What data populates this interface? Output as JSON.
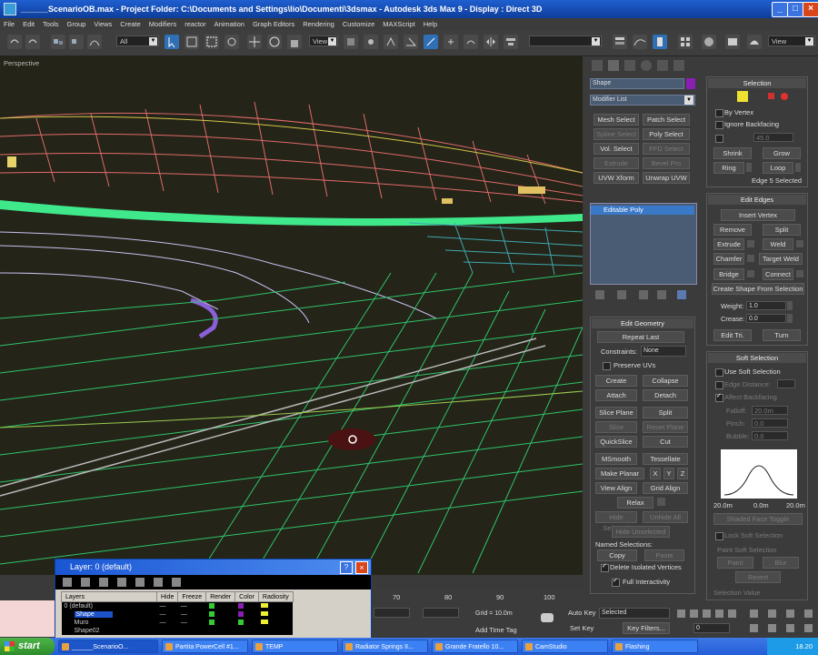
{
  "title": {
    "text": "______ScenarioOB.max - Project Folder: C:\\Documents and Settings\\lio\\Documenti\\3dsmax - Autodesk 3ds Max 9 - Display : Direct 3D"
  },
  "menu": [
    "File",
    "Edit",
    "Tools",
    "Group",
    "Views",
    "Create",
    "Modifiers",
    "reactor",
    "Animation",
    "Graph Editors",
    "Rendering",
    "Customize",
    "MAXScript",
    "Help"
  ],
  "toolbar": {
    "selection_filter": "All",
    "ref_coord": "View",
    "named_sel": "",
    "view2": "View"
  },
  "viewport": {
    "label": "Perspective"
  },
  "command_panel": {
    "object_name": "Shape",
    "object_color": "#8a1fb4",
    "modifier_list": "Modifier List",
    "modifier_buttons": [
      {
        "label": "Mesh Select",
        "enabled": true
      },
      {
        "label": "Patch Select",
        "enabled": true
      },
      {
        "label": "Spline Select",
        "enabled": false
      },
      {
        "label": "Poly Select",
        "enabled": true
      },
      {
        "label": "Vol. Select",
        "enabled": true
      },
      {
        "label": "FFD Select",
        "enabled": false
      },
      {
        "label": "Extrude",
        "enabled": false
      },
      {
        "label": "Bevel Pro",
        "enabled": false
      },
      {
        "label": "UVW Xform",
        "enabled": true
      },
      {
        "label": "Unwrap UVW",
        "enabled": true
      }
    ],
    "stack_item": "Editable Poly",
    "edit_geometry": {
      "title": "Edit Geometry",
      "repeat_last": "Repeat Last",
      "constraints_label": "Constraints:",
      "constraints_value": "None",
      "preserve_uvs": "Preserve UVs",
      "buttons": [
        {
          "label": "Create",
          "enabled": true
        },
        {
          "label": "Collapse",
          "enabled": true
        },
        {
          "label": "Attach",
          "enabled": true
        },
        {
          "label": "Detach",
          "enabled": true
        },
        {
          "label": "Slice Plane",
          "enabled": true
        },
        {
          "label": "Split",
          "enabled": true
        },
        {
          "label": "Slice",
          "enabled": false
        },
        {
          "label": "Reset Plane",
          "enabled": false
        },
        {
          "label": "QuickSlice",
          "enabled": true
        },
        {
          "label": "Cut",
          "enabled": true
        },
        {
          "label": "MSmooth",
          "enabled": true
        },
        {
          "label": "Tessellate",
          "enabled": true
        },
        {
          "label": "Make Planar",
          "enabled": true
        },
        {
          "label": "X",
          "enabled": true
        },
        {
          "label": "Y",
          "enabled": true
        },
        {
          "label": "Z",
          "enabled": true
        },
        {
          "label": "View Align",
          "enabled": true
        },
        {
          "label": "Grid Align",
          "enabled": true
        },
        {
          "label": "Relax",
          "enabled": true
        },
        {
          "label": "Hide Selected",
          "enabled": false
        },
        {
          "label": "Unhide All",
          "enabled": false
        },
        {
          "label": "Hide Unselected",
          "enabled": false
        }
      ],
      "named_selections": "Named Selections:",
      "copy": "Copy",
      "paste": "Paste",
      "delete_isolated": "Delete Isolated Vertices",
      "full_interactivity": "Full Interactivity"
    },
    "selection": {
      "title": "Selection",
      "by_vertex": "By Vertex",
      "ignore_backfacing": "Ignore Backfacing",
      "by_angle_value": "45.0",
      "shrink": "Shrink",
      "grow": "Grow",
      "ring": "Ring",
      "loop": "Loop",
      "status": "Edge 5 Selected"
    },
    "edit_edges": {
      "title": "Edit Edges",
      "insert_vertex": "Insert Vertex",
      "remove": "Remove",
      "split": "Split",
      "extrude": "Extrude",
      "weld": "Weld",
      "chamfer": "Chamfer",
      "target_weld": "Target Weld",
      "bridge": "Bridge",
      "connect": "Connect",
      "create_shape": "Create Shape From Selection",
      "weight_label": "Weight:",
      "weight_value": "1.0",
      "crease_label": "Crease:",
      "crease_value": "0.0",
      "edit_tri": "Edit Tri.",
      "turn": "Turn"
    },
    "soft_selection": {
      "title": "Soft Selection",
      "use_soft": "Use Soft Selection",
      "edge_distance": "Edge Distance:",
      "affect_backfacing": "Affect Backfacing",
      "falloff": "Falloff:",
      "falloff_value": "20.0m",
      "pinch": "Pinch:",
      "pinch_value": "0.0",
      "bubble": "Bubble:",
      "bubble_value": "0.0",
      "curve_labels": [
        "20.0m",
        "0.0m",
        "20.0m"
      ],
      "shaded_face": "Shaded Face Toggle",
      "lock_soft": "Lock Soft Selection",
      "paint_title": "Paint Soft Selection",
      "paint": "Paint",
      "blur": "Blur",
      "revert": "Revert",
      "selection_value": "Selection Value"
    }
  },
  "layer_dialog": {
    "title": "Layer: 0 (default)",
    "columns": [
      "Layers",
      "Hide",
      "Freeze",
      "Render",
      "Color",
      "Radiosity"
    ],
    "rows": [
      "0 (default)",
      "Shape",
      "Muro",
      "Shape02"
    ]
  },
  "status": {
    "ticks": [
      "70",
      "80",
      "90",
      "100"
    ],
    "grid": "Grid = 10.0m",
    "add_time_tag": "Add Time Tag",
    "auto_key": "Auto Key",
    "set_key": "Set Key",
    "key_mode": "Selected",
    "key_filters": "Key Filters...",
    "frame": "0"
  },
  "taskbar": {
    "start": "start",
    "tasks": [
      "______ScenarioO...",
      "Partita PowerCell #1...",
      "TEMP",
      "Radiator Springs II...",
      "Grande Fratello 10...",
      "CamStudio",
      "Flashing"
    ],
    "clock": "18.20"
  }
}
